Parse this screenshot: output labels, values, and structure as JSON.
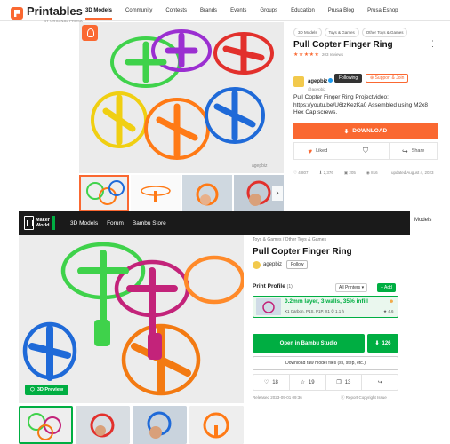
{
  "printables": {
    "logo": {
      "name": "Printables",
      "sub": "BY ORIGINAL PRUSA"
    },
    "nav": [
      "3D Models",
      "Community",
      "Contests",
      "Brands",
      "Events",
      "Groups",
      "Education",
      "Prusa Blog",
      "Prusa Eshop"
    ],
    "breadcrumbs": [
      "3D Models",
      "Toys & Games",
      "Other Toys & Games"
    ],
    "title": "Pull Copter Finger Ring",
    "rating_stars": "★★★★★",
    "reviews": "203 reviews",
    "author": {
      "name": "agepbiz",
      "handle": "@agepbiz"
    },
    "follow_label": "Following",
    "support_label": "Support & Join",
    "description": "Pull Copter Finger Ring Projectvideo: https://youtu.be/U6tzKezKa0 Assembled using M2x8 Hex Cap screws.",
    "download_label": "DOWNLOAD",
    "actions": {
      "liked": "Liked",
      "share": "Share"
    },
    "stats": [
      "4,807",
      "2,376",
      "205",
      "816"
    ],
    "updated": "updated August 4, 2023",
    "watermark": "agepbiz",
    "models_fragment": "Models",
    "colors": {
      "accent": "#fa6831"
    }
  },
  "makerworld": {
    "logo": {
      "line1": "Maker",
      "line2": "World"
    },
    "nav": [
      "3D Models",
      "Forum",
      "Bambu Store"
    ],
    "breadcrumbs": "Toys & Games / Other Toys & Games",
    "title": "Pull Copter Finger Ring",
    "author": "agepbiz",
    "follow_label": "Follow",
    "preview_label": "3D Preview",
    "profile": {
      "header": "Print Profile",
      "count": "(1)",
      "printers": "All Printers",
      "add": "+ Add",
      "title": "0.2mm layer, 3 walls, 35% infill",
      "meta": "X1 Carbon, P1S, P1P, X1  ⏱ 1.1 h",
      "rating": "★ 4.6"
    },
    "open_label": "Open in Bambu Studio",
    "download_count": "126",
    "raw_label": "Download raw model files (stl, step, etc.)",
    "actions": {
      "likes": "18",
      "stars": "19",
      "remixes": "13"
    },
    "released": "Released 2023-09-01 09:36",
    "report": "Report Copyright Issue",
    "colors": {
      "accent": "#00ae42"
    }
  }
}
